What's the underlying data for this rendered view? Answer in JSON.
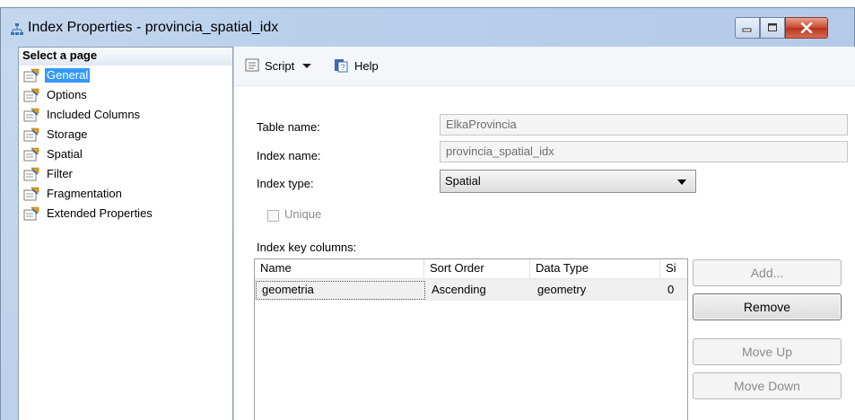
{
  "window": {
    "title": "Index Properties - provincia_spatial_idx"
  },
  "left_pane": {
    "header": "Select a page",
    "items": [
      {
        "label": "General",
        "selected": true
      },
      {
        "label": "Options",
        "selected": false
      },
      {
        "label": "Included Columns",
        "selected": false
      },
      {
        "label": "Storage",
        "selected": false
      },
      {
        "label": "Spatial",
        "selected": false
      },
      {
        "label": "Filter",
        "selected": false
      },
      {
        "label": "Fragmentation",
        "selected": false
      },
      {
        "label": "Extended Properties",
        "selected": false
      }
    ]
  },
  "toolbar": {
    "script_label": "Script",
    "help_label": "Help"
  },
  "form": {
    "table_name_label": "Table name:",
    "table_name_value": "ElkaProvincia",
    "index_name_label": "Index name:",
    "index_name_value": "provincia_spatial_idx",
    "index_type_label": "Index type:",
    "index_type_value": "Spatial",
    "unique_label": "Unique",
    "key_columns_label": "Index key columns:"
  },
  "grid": {
    "columns": [
      "Name",
      "Sort Order",
      "Data Type",
      "Si"
    ],
    "rows": [
      {
        "name": "geometria",
        "sort_order": "Ascending",
        "data_type": "geometry",
        "size": "0"
      }
    ]
  },
  "buttons": {
    "add": "Add...",
    "remove": "Remove",
    "move_up": "Move Up",
    "move_down": "Move Down"
  },
  "colors": {
    "selection": "#3399ff",
    "close_button": "#c9462c"
  }
}
